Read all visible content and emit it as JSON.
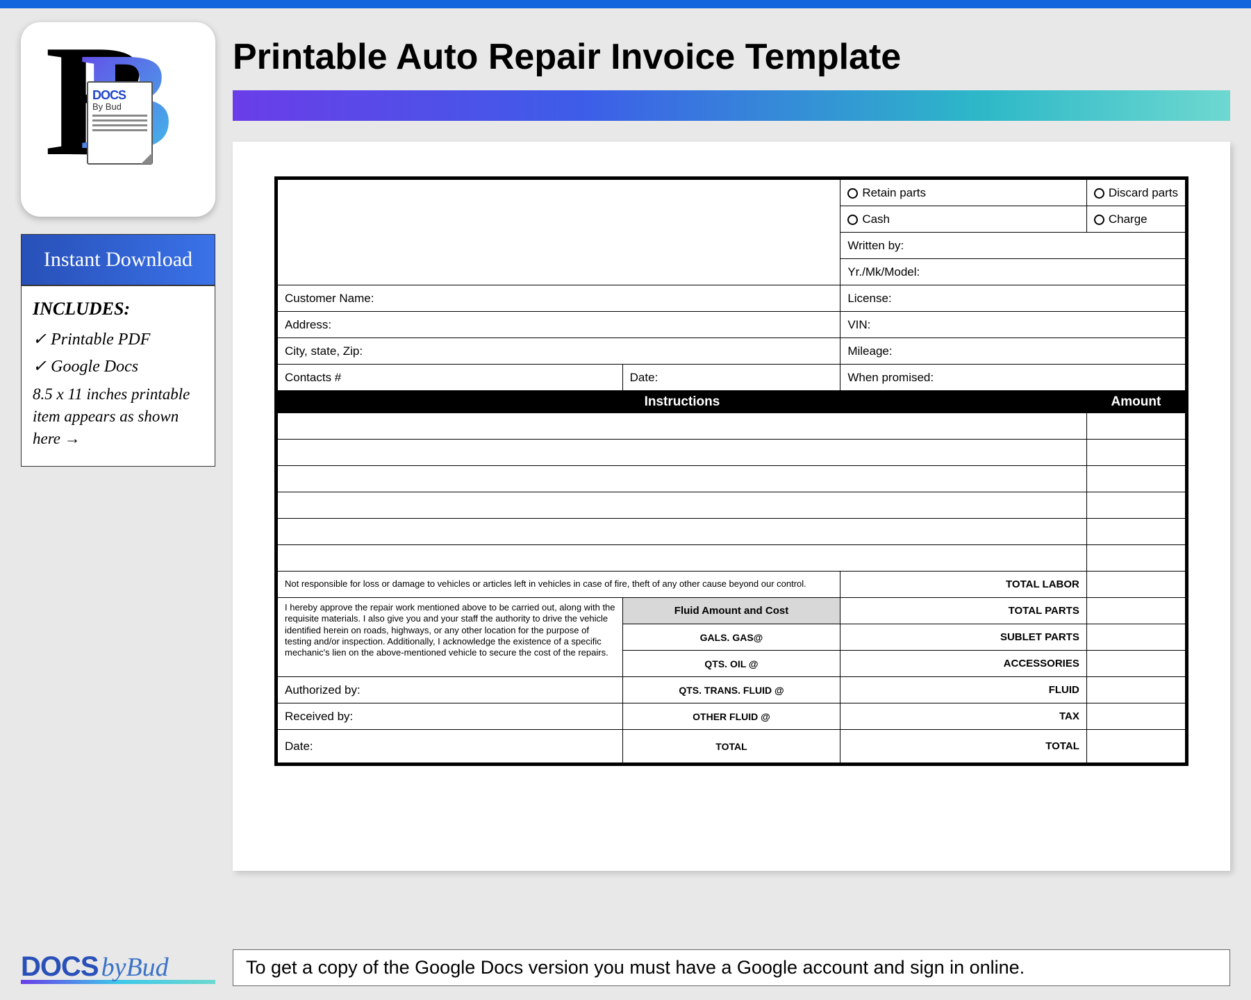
{
  "header": {
    "title": "Printable Auto Repair Invoice Template"
  },
  "logo": {
    "docs": "DOCS",
    "bybud": "By Bud"
  },
  "sidebar": {
    "instant": "Instant Download",
    "includes_title": "INCLUDES:",
    "item1": "✓ Printable PDF",
    "item2": "✓ Google Docs",
    "desc": "8.5 x 11 inches printable item appears as shown here →"
  },
  "invoice": {
    "retain": "Retain parts",
    "discard": "Discard parts",
    "cash": "Cash",
    "charge": "Charge",
    "written_by": "Written by:",
    "yr_mk_model": "Yr./Mk/Model:",
    "customer_name": "Customer Name:",
    "license": "License:",
    "address": "Address:",
    "vin": "VIN:",
    "city_state_zip": "City, state, Zip:",
    "mileage": "Mileage:",
    "contacts": "Contacts #",
    "date": "Date:",
    "when_promised": "When promised:",
    "instructions": "Instructions",
    "amount": "Amount",
    "disclaimer": "Not responsible for loss or damage to vehicles or articles left in vehicles in case of fire, theft of any other cause beyond our control.",
    "approval": "I hereby approve the repair work mentioned above to be carried out, along with the requisite materials. I also give you and your staff the authority to drive the vehicle identified herein on roads, highways, or any other location for the purpose of testing and/or inspection. Additionally, I acknowledge the existence of a specific mechanic's lien on the above-mentioned vehicle to secure the cost of the repairs.",
    "authorized_by": "Authorized by:",
    "received_by": "Received by:",
    "date2": "Date:",
    "fluid_header": "Fluid Amount and Cost",
    "gals_gas": "GALS. GAS@",
    "qts_oil": "QTS. OIL @",
    "qts_trans": "QTS. TRANS. FLUID @",
    "other_fluid": "OTHER FLUID @",
    "fluid_total": "TOTAL",
    "total_labor": "TOTAL LABOR",
    "total_parts": "TOTAL PARTS",
    "sublet_parts": "SUBLET PARTS",
    "accessories": "ACCESSORIES",
    "fluid": "FLUID",
    "tax": "TAX",
    "grand_total": "TOTAL"
  },
  "footer": {
    "docs": "DOCS",
    "bybud": "byBud",
    "message": "To get a copy of the Google Docs version you must have a Google account and sign in online."
  }
}
